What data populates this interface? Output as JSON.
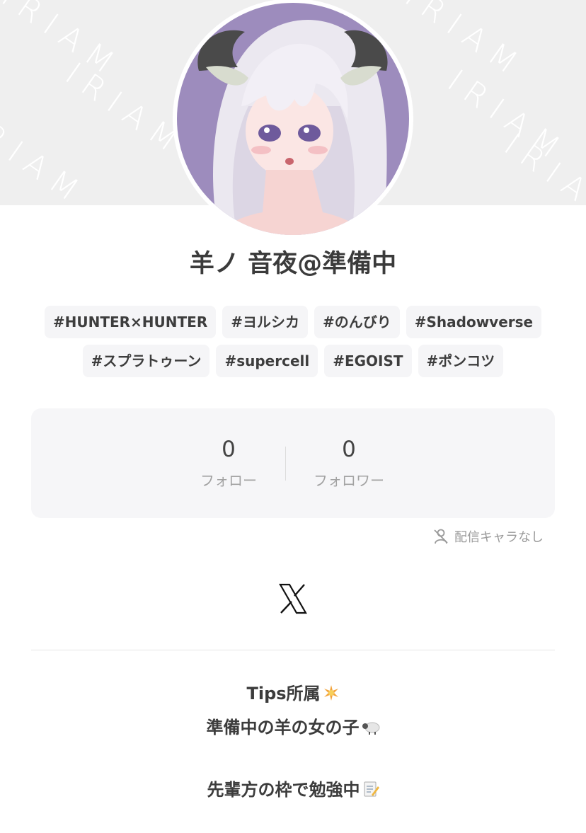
{
  "banner": {
    "watermark": "IRIAM"
  },
  "profile": {
    "name": "羊ノ 音夜@準備中"
  },
  "tags": {
    "row1": [
      "#HUNTER×HUNTER",
      "#ヨルシカ",
      "#のんびり",
      "#Shadowverse"
    ],
    "row2": [
      "#スプラトゥーン",
      "#supercell",
      "#EGOIST",
      "#ポンコツ"
    ]
  },
  "stats": {
    "follow": {
      "count": "0",
      "label": "フォロー"
    },
    "followers": {
      "count": "0",
      "label": "フォロワー"
    }
  },
  "character_status": {
    "label": "配信キャラなし",
    "icon": "no-character-icon"
  },
  "social": {
    "icon": "x-logo-icon"
  },
  "bio": {
    "line1": "Tips所属",
    "line1_emoji": "sparkle-icon",
    "line2": "準備中の羊の女の子",
    "line2_emoji": "sheep-icon",
    "line3": "先輩方の枠で勉強中",
    "line3_emoji": "memo-icon"
  },
  "colors": {
    "avatar_bg": "#9d8cbd",
    "banner_bg": "#efefef",
    "card_bg": "#f6f6f8",
    "tag_bg": "#f5f5f7"
  }
}
